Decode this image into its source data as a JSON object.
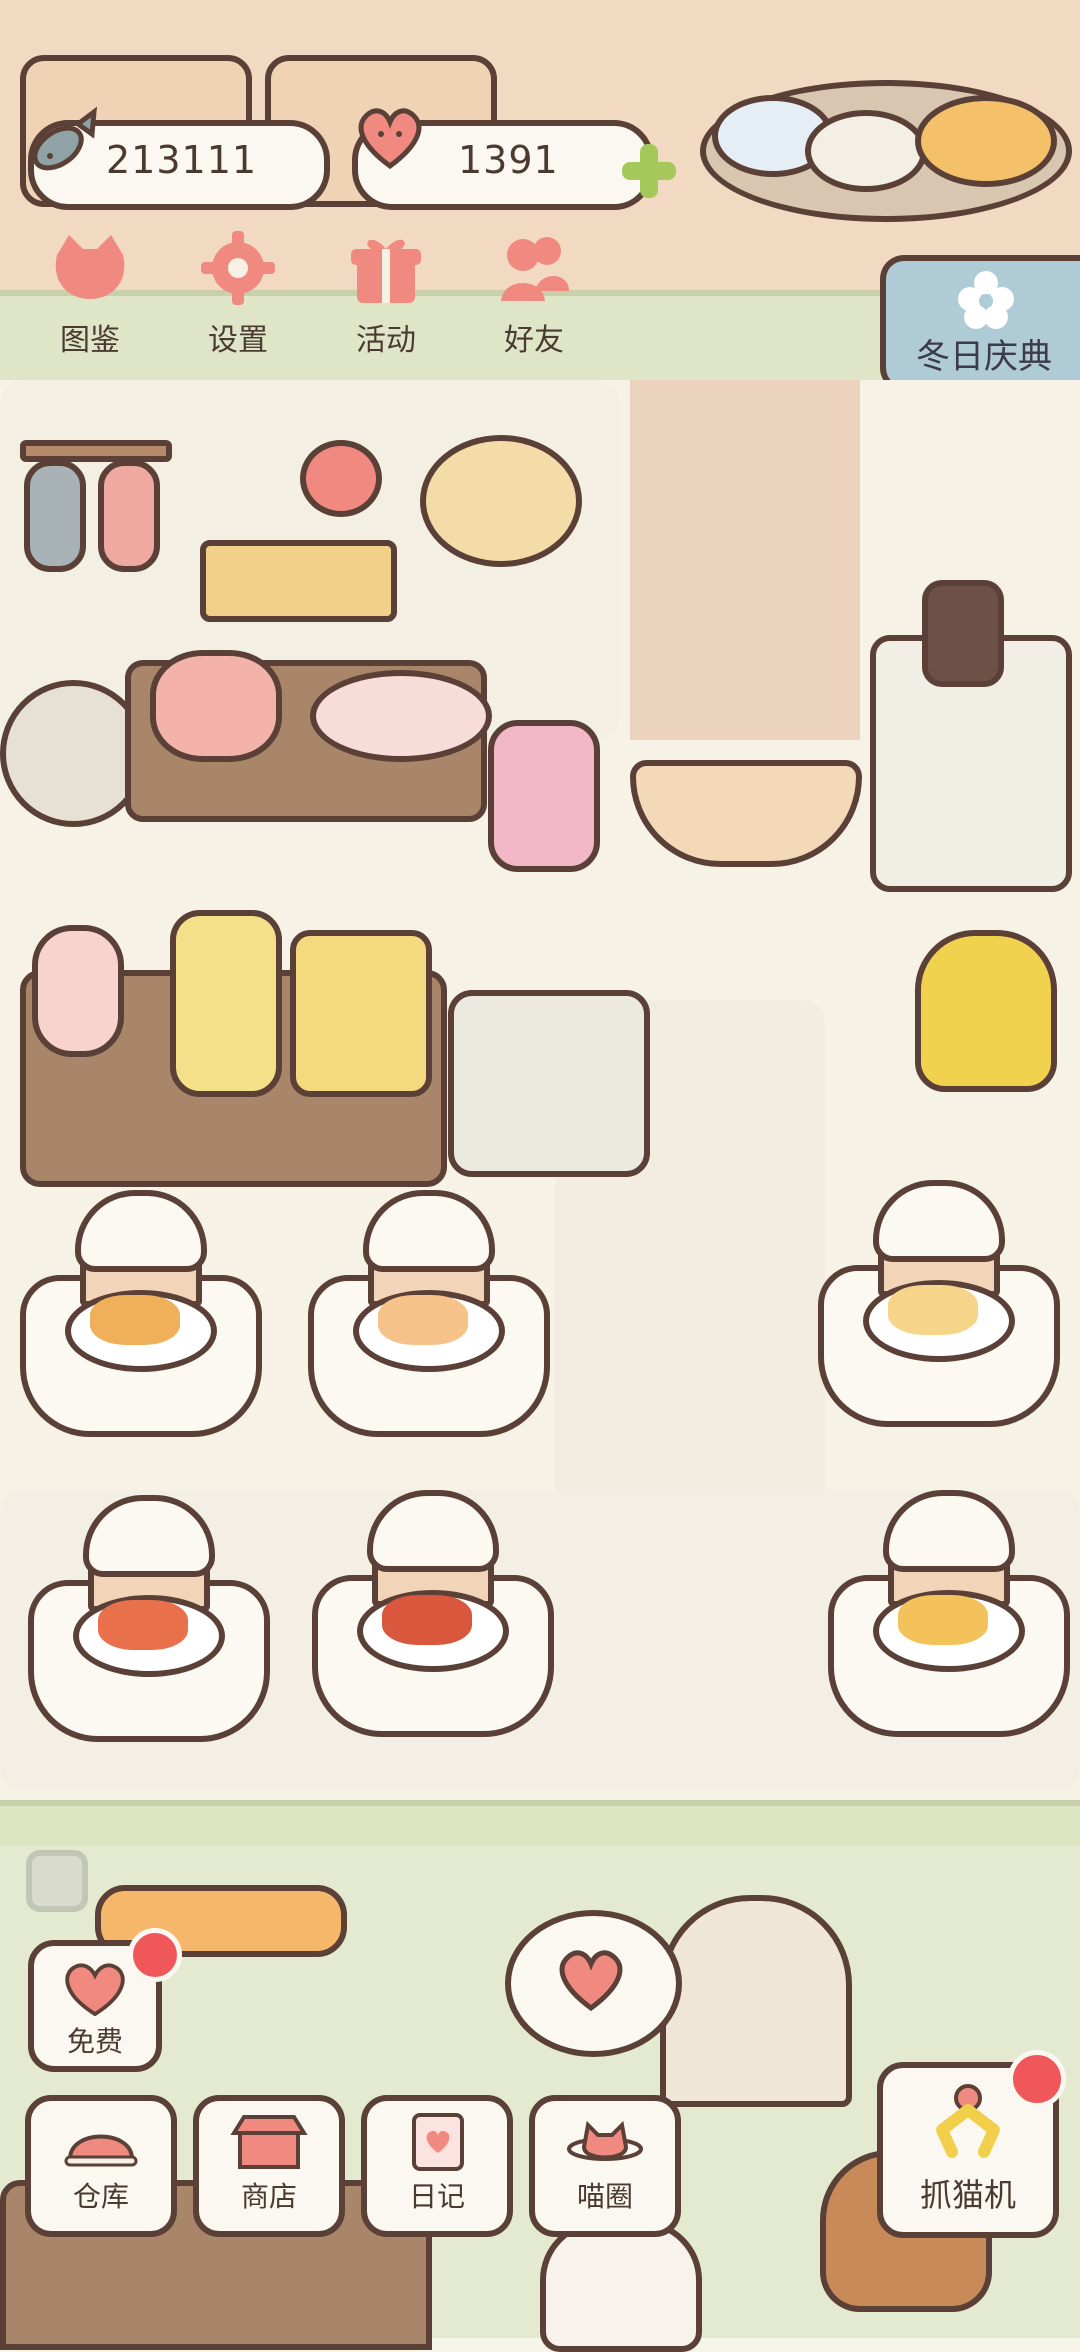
{
  "currency": {
    "fish": {
      "icon": "fish-icon",
      "value": "213111"
    },
    "hearts": {
      "icon": "heart-cat-icon",
      "value": "1391",
      "add_icon": "plus-icon"
    }
  },
  "top_menu": [
    {
      "id": "collection",
      "label": "图鉴",
      "icon": "cat-head-icon"
    },
    {
      "id": "settings",
      "label": "设置",
      "icon": "gear-icon"
    },
    {
      "id": "events",
      "label": "活动",
      "icon": "gift-icon"
    },
    {
      "id": "friends",
      "label": "好友",
      "icon": "friends-icon"
    }
  ],
  "festival": {
    "label": "冬日庆典",
    "icon": "snowflake-icon"
  },
  "bottom_menu": {
    "free": {
      "label": "免费",
      "icon": "heart-cat-icon",
      "badge": true
    },
    "storage": {
      "label": "仓库",
      "icon": "dome-icon"
    },
    "shop": {
      "label": "商店",
      "icon": "store-icon"
    },
    "diary": {
      "label": "日记",
      "icon": "notebook-icon"
    },
    "cat_circle": {
      "label": "喵圈",
      "icon": "cat-planet-icon"
    },
    "claw_machine": {
      "label": "抓猫机",
      "icon": "claw-icon",
      "badge": true
    }
  },
  "colors": {
    "outline": "#5a4036",
    "accent_pink": "#f08a80",
    "badge_red": "#f0575a",
    "plus_green": "#a4c85a",
    "festival_blue": "#aecbd6"
  }
}
